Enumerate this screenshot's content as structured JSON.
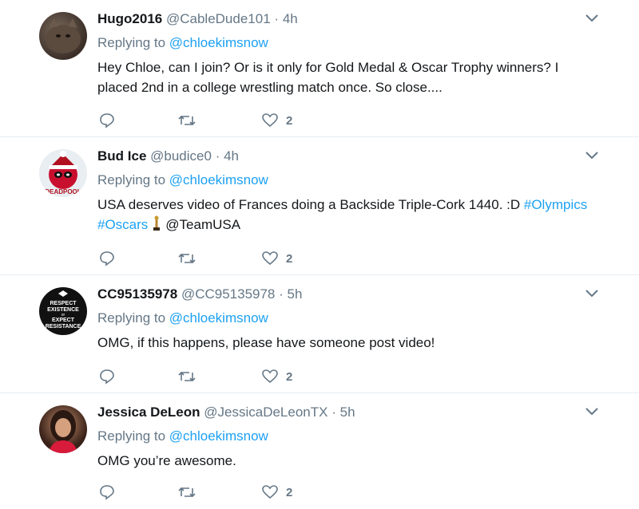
{
  "tweets": [
    {
      "name": "Hugo2016",
      "handle": "@CableDude101",
      "separator": "·",
      "time": "4h",
      "replying_prefix": "Replying to ",
      "replying_to": "@chloekimsnow",
      "text": "Hey Chloe, can I join? Or is it only for Gold Medal & Oscar Trophy winners? I placed 2nd in a college wrestling match once. So close....",
      "likes": "2"
    },
    {
      "name": "Bud Ice",
      "handle": "@budice0",
      "separator": "·",
      "time": "4h",
      "replying_prefix": "Replying to ",
      "replying_to": "@chloekimsnow",
      "text_before": "USA deserves video of Frances doing a Backside Triple-Cork 1440. :D ",
      "hashtag1": "#Olympics",
      "hashtag2": "#Oscars",
      "mention": "@TeamUSA",
      "avatar_text": "DEADPOOL",
      "likes": "2"
    },
    {
      "name": "CC95135978",
      "handle": "@CC95135978",
      "separator": "·",
      "time": "5h",
      "replying_prefix": "Replying to ",
      "replying_to": "@chloekimsnow",
      "text": "OMG, if this happens, please have someone post video!",
      "avatar_lines": [
        "RESPECT",
        "EXISTENCE",
        "or",
        "EXPECT",
        "RESISTANCE"
      ],
      "likes": "2"
    },
    {
      "name": "Jessica DeLeon",
      "handle": "@JessicaDeLeonTX",
      "separator": "·",
      "time": "5h",
      "replying_prefix": "Replying to ",
      "replying_to": "@chloekimsnow",
      "text": "OMG you’re awesome.",
      "likes": "2"
    }
  ],
  "icons": {
    "reply": "reply-icon",
    "retweet": "retweet-icon",
    "like": "heart-icon",
    "more": "chevron-down-icon",
    "emoji": "trophy-icon"
  },
  "colors": {
    "link": "#1da1f2",
    "secondary": "#657786",
    "text": "#14171a",
    "border": "#e6ecf0"
  }
}
